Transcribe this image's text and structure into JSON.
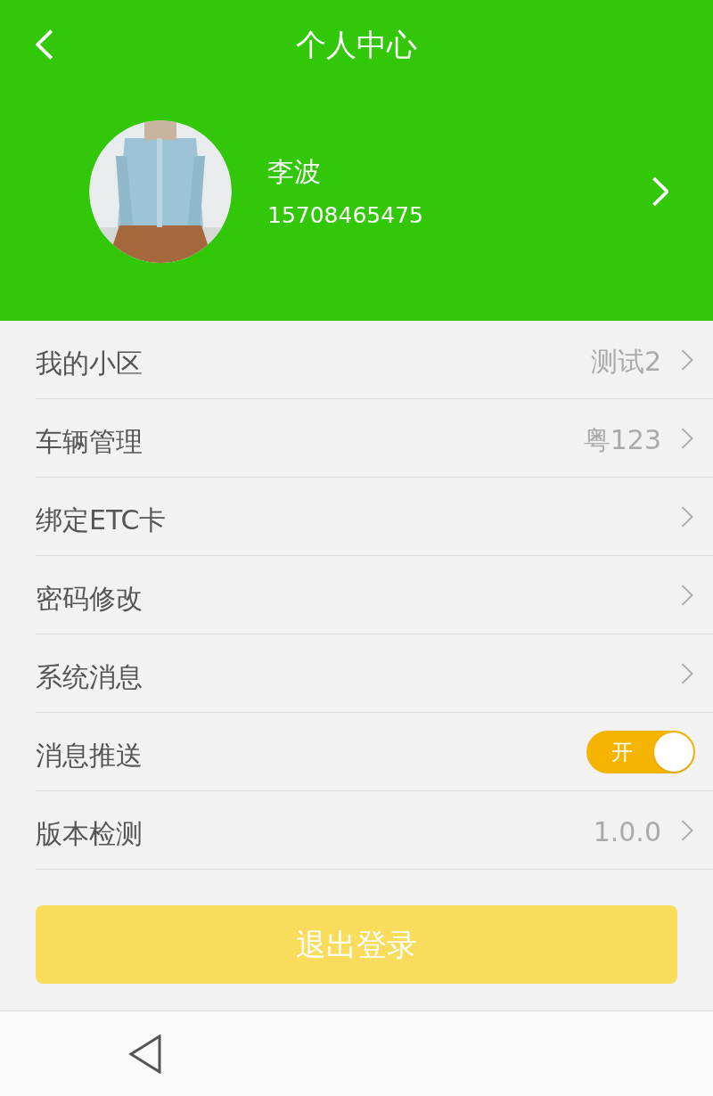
{
  "header": {
    "title": "个人中心"
  },
  "profile": {
    "name": "李波",
    "phone": "15708465475"
  },
  "rows": [
    {
      "kind": "link",
      "label": "我的小区",
      "value": "测试2"
    },
    {
      "kind": "link",
      "label": "车辆管理",
      "value": "粤123"
    },
    {
      "kind": "link",
      "label": "绑定ETC卡"
    },
    {
      "kind": "link",
      "label": "密码修改"
    },
    {
      "kind": "link",
      "label": "系统消息"
    },
    {
      "kind": "toggle",
      "label": "消息推送",
      "on": true,
      "toggle_label": "开"
    },
    {
      "kind": "link",
      "label": "版本检测",
      "value": "1.0.0"
    }
  ],
  "logout_button": "退出登录"
}
